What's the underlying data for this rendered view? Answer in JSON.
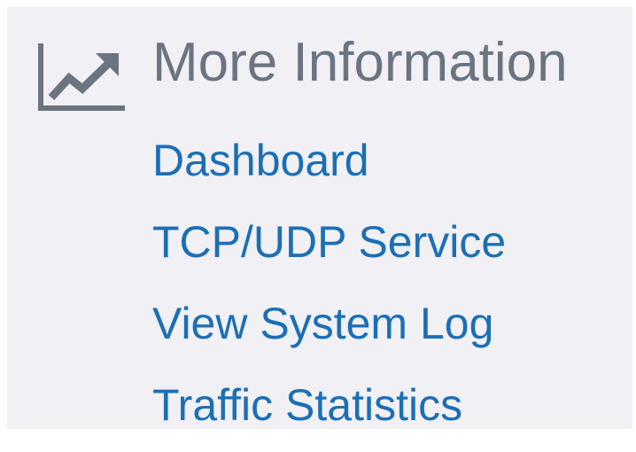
{
  "section": {
    "icon": "trending-chart-icon",
    "title": "More Information"
  },
  "links": [
    {
      "label": "Dashboard"
    },
    {
      "label": "TCP/UDP Service"
    },
    {
      "label": "View System Log"
    },
    {
      "label": "Traffic Statistics"
    }
  ],
  "colors": {
    "background": "#f1f0f5",
    "title": "#6b7481",
    "icon": "#6b7481",
    "link": "#1b6fb5"
  }
}
